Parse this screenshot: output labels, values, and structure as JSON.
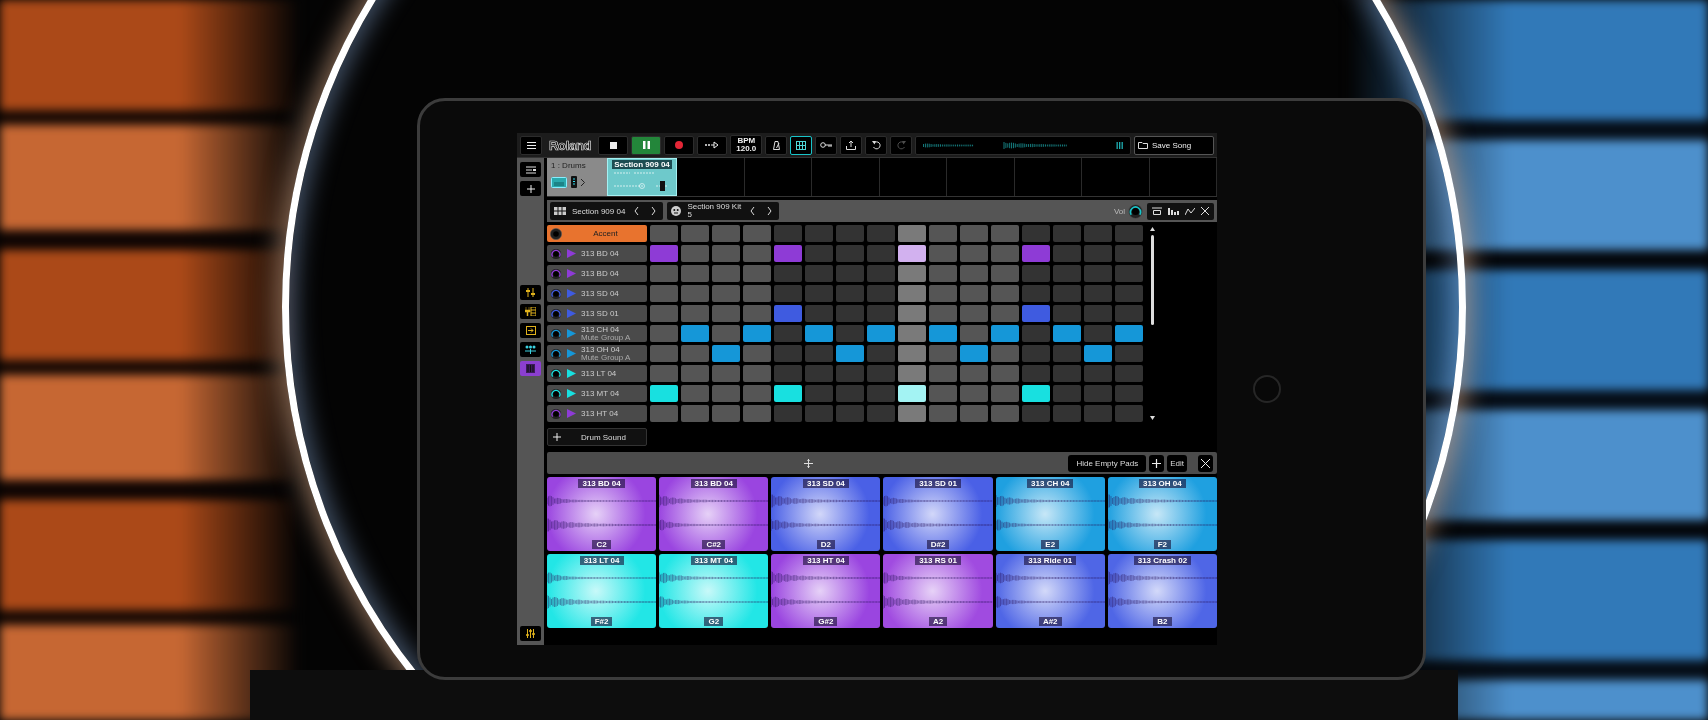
{
  "top_bar": {
    "logo": "Roland",
    "transport": [
      {
        "kind": "stop",
        "on": false
      },
      {
        "kind": "pause",
        "on": true
      },
      {
        "kind": "record",
        "on": false
      },
      {
        "kind": "follow",
        "on": false
      }
    ],
    "bpm_label": "BPM",
    "bpm": "120.0",
    "grid_view": {
      "selected": true
    },
    "redo": {
      "disabled": true
    },
    "save": "Save Song"
  },
  "track": {
    "name": "1 : Drums",
    "clip": "Section 909 04"
  },
  "pattern_bar": {
    "pattern": "Section 909 04",
    "kit": "Section 909 Kit",
    "kit_line_2": "5",
    "volume_label": "Vol"
  },
  "side_tools": [
    {
      "kind": "sliders",
      "selected": false
    },
    {
      "kind": "insert",
      "selected": false
    },
    {
      "kind": "routing",
      "selected": false
    },
    {
      "kind": "group",
      "selected": false
    },
    {
      "kind": "pattern",
      "selected": true
    }
  ],
  "step_columns": [
    {
      "selected": false
    },
    {
      "selected": false
    },
    {
      "selected": false
    },
    {
      "selected": false
    },
    {
      "selected": false
    },
    {
      "selected": false
    },
    {
      "selected": false
    },
    {
      "selected": false
    },
    {
      "selected": true
    },
    {
      "selected": false
    },
    {
      "selected": false
    },
    {
      "selected": false
    },
    {
      "selected": false
    },
    {
      "selected": false
    },
    {
      "selected": false
    },
    {
      "selected": false
    }
  ],
  "rows": [
    {
      "kind": "accent",
      "name": "Accent",
      "color": "#e8732e",
      "steps": [
        false,
        false,
        false,
        false,
        false,
        false,
        false,
        false,
        false,
        false,
        false,
        false,
        false,
        false,
        false,
        false
      ]
    },
    {
      "kind": "sound",
      "name": "313 BD 04",
      "color": "#8e3bd6",
      "steps": [
        true,
        false,
        false,
        false,
        true,
        false,
        false,
        false,
        true,
        false,
        false,
        false,
        true,
        false,
        false,
        false
      ]
    },
    {
      "kind": "sound",
      "name": "313 BD 04",
      "color": "#8e3bd6",
      "steps": [
        false,
        false,
        false,
        false,
        false,
        false,
        false,
        false,
        false,
        false,
        false,
        false,
        false,
        false,
        false,
        false
      ]
    },
    {
      "kind": "sound",
      "name": "313 SD 04",
      "color": "#3f5be0",
      "steps": [
        false,
        false,
        false,
        false,
        false,
        false,
        false,
        false,
        false,
        false,
        false,
        false,
        false,
        false,
        false,
        false
      ]
    },
    {
      "kind": "sound",
      "name": "313 SD 01",
      "color": "#3f5be0",
      "steps": [
        false,
        false,
        false,
        false,
        true,
        false,
        false,
        false,
        false,
        false,
        false,
        false,
        true,
        false,
        false,
        false
      ]
    },
    {
      "kind": "sound",
      "name": "313 CH 04",
      "sublabel": "Mute Group A",
      "color": "#1597d8",
      "steps": [
        false,
        true,
        false,
        true,
        false,
        true,
        false,
        true,
        false,
        true,
        false,
        true,
        false,
        true,
        false,
        true
      ]
    },
    {
      "kind": "sound",
      "name": "313 OH 04",
      "sublabel": "Mute Group A",
      "color": "#1597d8",
      "steps": [
        false,
        false,
        true,
        false,
        false,
        false,
        true,
        false,
        false,
        false,
        true,
        false,
        false,
        false,
        true,
        false
      ]
    },
    {
      "kind": "sound",
      "name": "313 LT 04",
      "color": "#18e0e0",
      "steps": [
        false,
        false,
        false,
        false,
        false,
        false,
        false,
        false,
        false,
        false,
        false,
        false,
        false,
        false,
        false,
        false
      ]
    },
    {
      "kind": "sound",
      "name": "313 MT 04",
      "color": "#18e0e0",
      "steps": [
        true,
        false,
        false,
        false,
        true,
        false,
        false,
        false,
        true,
        false,
        false,
        false,
        true,
        false,
        false,
        false
      ]
    },
    {
      "kind": "sound",
      "name": "313 HT 04",
      "color": "#8e3bd6",
      "steps": [
        false,
        false,
        false,
        false,
        false,
        false,
        false,
        false,
        false,
        false,
        false,
        false,
        false,
        false,
        false,
        false
      ]
    }
  ],
  "add_sound": "Drum Sound",
  "pad_bar": {
    "hide_empty": "Hide Empty Pads",
    "edit": "Edit"
  },
  "pads": [
    {
      "name": "313 BD 04",
      "note": "C2",
      "color": "#9a45e0"
    },
    {
      "name": "313 BD 04",
      "note": "C#2",
      "color": "#9a45e0"
    },
    {
      "name": "313 SD 04",
      "note": "D2",
      "color": "#4a60e6"
    },
    {
      "name": "313 SD 01",
      "note": "D#2",
      "color": "#4a60e6"
    },
    {
      "name": "313 CH 04",
      "note": "E2",
      "color": "#1fa0e0"
    },
    {
      "name": "313 OH 04",
      "note": "F2",
      "color": "#1fa0e0"
    },
    {
      "name": "313 LT 04",
      "note": "F#2",
      "color": "#22e6e6"
    },
    {
      "name": "313 MT 04",
      "note": "G2",
      "color": "#22e6e6"
    },
    {
      "name": "313 HT 04",
      "note": "G#2",
      "color": "#9a45e0"
    },
    {
      "name": "313 RS 01",
      "note": "A2",
      "color": "#a04be0"
    },
    {
      "name": "313 Ride 01",
      "note": "A#2",
      "color": "#4f66e6"
    },
    {
      "name": "313 Crash 02",
      "note": "B2",
      "color": "#4f66e6"
    }
  ]
}
